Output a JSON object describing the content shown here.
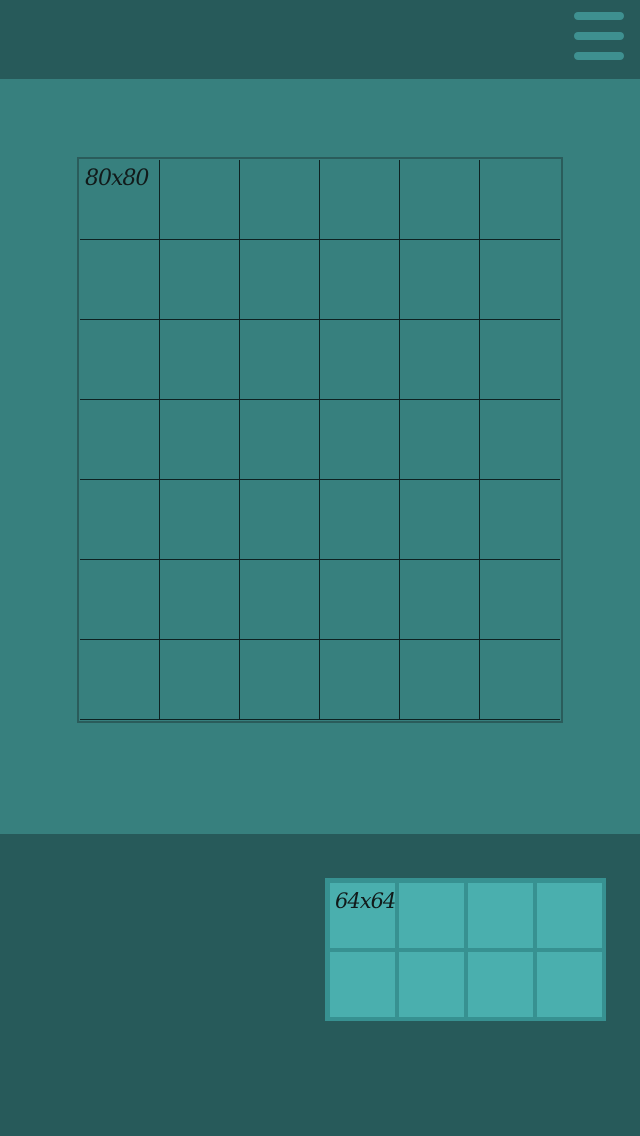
{
  "menu": {
    "icon": "hamburger-menu-icon"
  },
  "board": {
    "rows": 7,
    "columns": 6,
    "cell_label": "80x80"
  },
  "tray": {
    "rows": 2,
    "columns": 4,
    "cell_label": "64x64"
  },
  "colors": {
    "header": "#275a5a",
    "play_area": "#37807e",
    "grid_lines": "#0d2222",
    "tray_frame": "#379191",
    "tray_cell": "#4aafae",
    "menu_bars": "#3e9090"
  }
}
